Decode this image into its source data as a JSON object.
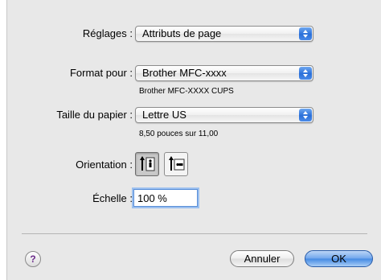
{
  "settings": {
    "label": "Réglages :",
    "value": "Attributs de page"
  },
  "format": {
    "label": "Format pour :",
    "value": "Brother MFC-xxxx",
    "subtext": "Brother MFC-XXXX CUPS"
  },
  "paper": {
    "label": "Taille du papier :",
    "value": "Lettre US",
    "subtext": "8,50 pouces sur 11,00"
  },
  "orientation": {
    "label": "Orientation :",
    "selected": "portrait"
  },
  "scale": {
    "label": "Échelle :",
    "value": "100 %"
  },
  "footer": {
    "help_label": "?",
    "cancel_label": "Annuler",
    "ok_label": "OK"
  }
}
